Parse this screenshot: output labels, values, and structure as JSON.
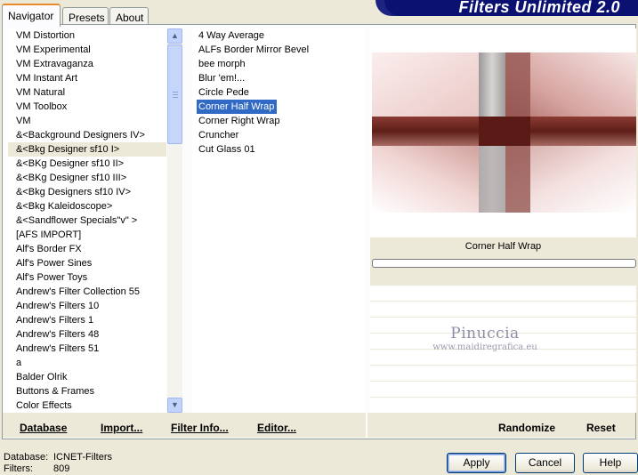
{
  "app": {
    "title": "Filters Unlimited 2.0"
  },
  "tabs": [
    {
      "label": "Navigator",
      "active": true
    },
    {
      "label": "Presets",
      "active": false
    },
    {
      "label": "About",
      "active": false
    }
  ],
  "categories": {
    "items": [
      "VM Distortion",
      "VM Experimental",
      "VM Extravaganza",
      "VM Instant Art",
      "VM Natural",
      "VM Toolbox",
      "VM",
      "&<Background Designers IV>",
      "&<Bkg Designer sf10 I>",
      "&<BKg Designer sf10 II>",
      "&<BKg Designer sf10 III>",
      "&<Bkg Designers sf10 IV>",
      "&<Bkg Kaleidoscope>",
      "&<Sandflower Specials\"v\" >",
      "[AFS IMPORT]",
      "Alf's Border FX",
      "Alf's Power Sines",
      "Alf's Power Toys",
      "Andrew's Filter Collection 55",
      "Andrew's Filters 10",
      "Andrew's Filters 1",
      "Andrew's Filters 48",
      "Andrew's Filters 51",
      "a",
      "Balder Olrik",
      "Buttons & Frames",
      "Color Effects"
    ],
    "selected_index": 8
  },
  "filters": {
    "items": [
      "4 Way Average",
      "ALFs Border Mirror Bevel",
      "bee morph",
      "Blur 'em!...",
      "Circle Pede",
      "Corner Half Wrap",
      "Corner Right Wrap",
      "Cruncher",
      "Cut Glass 01"
    ],
    "selected_index": 5
  },
  "preview": {
    "caption": "Corner Half Wrap",
    "watermark_name": "Pinuccia",
    "watermark_url": "www.maidiregrafica.eu"
  },
  "bottom_bar": {
    "database": "Database",
    "import": "Import...",
    "filter_info": "Filter Info...",
    "editor": "Editor...",
    "randomize": "Randomize",
    "reset": "Reset"
  },
  "status": {
    "database_label": "Database:",
    "database_value": "ICNET-Filters",
    "filters_label": "Filters:",
    "filters_value": "809"
  },
  "dialog": {
    "apply": "Apply",
    "cancel": "Cancel",
    "help": "Help"
  },
  "colors": {
    "selection": "#316ac5",
    "banner": "#0a1170",
    "tab_accent": "#e68b2c",
    "face": "#ece9d8"
  }
}
